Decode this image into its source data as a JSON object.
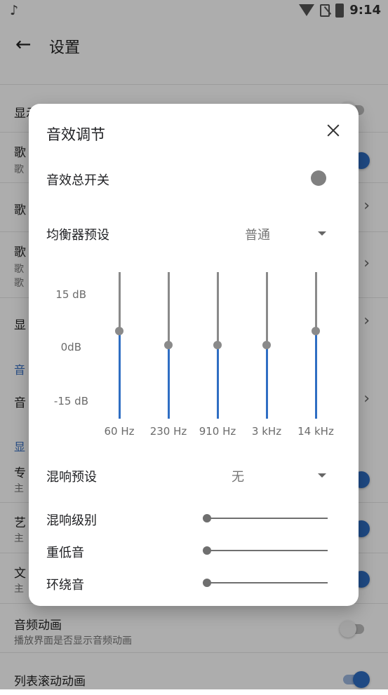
{
  "status_bar": {
    "time": "9:14"
  },
  "app_bar": {
    "title": "设置"
  },
  "settings": {
    "row1_title": "显示",
    "row2_title": "歌",
    "row2_sub": "歌",
    "row3_title": "歌",
    "row4_title": "歌",
    "row4_sub1": "歌",
    "row4_sub2": "歌",
    "row5_title": "显",
    "section1": "音",
    "row6_title": "音",
    "section2": "显",
    "row7_title": "专",
    "row7_sub": "主",
    "row8_title": "艺",
    "row8_sub": "主",
    "row9_title": "文",
    "row9_sub": "主",
    "audio_anim_title": "音频动画",
    "audio_anim_sub": "播放界面是否显示音频动画",
    "list_anim_title": "列表滚动动画"
  },
  "dialog": {
    "title": "音效调节",
    "master_switch_label": "音效总开关",
    "eq_preset_label": "均衡器预设",
    "eq_preset_value": "普通",
    "db_labels": [
      "15 dB",
      "0dB",
      "-15 dB"
    ],
    "bands": [
      {
        "freq": "60 Hz",
        "gain_db": 3
      },
      {
        "freq": "230 Hz",
        "gain_db": 0
      },
      {
        "freq": "910 Hz",
        "gain_db": 0
      },
      {
        "freq": "3 kHz",
        "gain_db": 0
      },
      {
        "freq": "14 kHz",
        "gain_db": 3
      }
    ],
    "reverb_preset_label": "混响预设",
    "reverb_preset_value": "无",
    "reverb_level_label": "混响级别",
    "bass_label": "重低音",
    "surround_label": "环绕音",
    "reverb_level_value": 0,
    "bass_value": 0,
    "surround_value": 0
  },
  "colors": {
    "accent": "#2f6ec3",
    "scrim": "#00000052"
  }
}
